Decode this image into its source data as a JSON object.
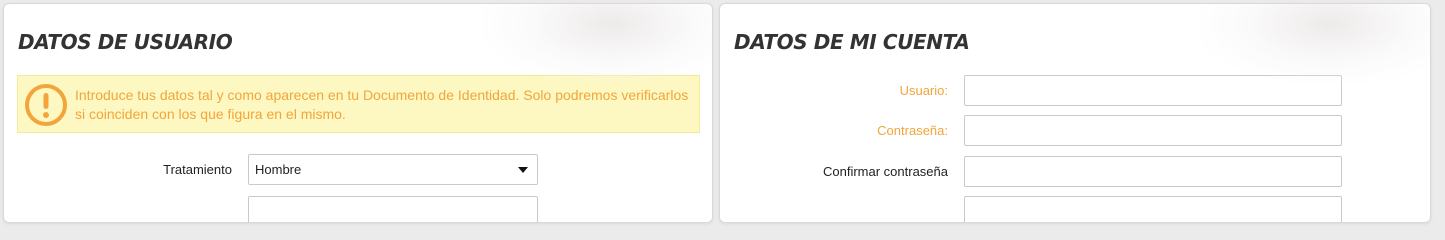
{
  "colors": {
    "accent": "#f2a53b",
    "alert_bg": "#fdf8c2",
    "title": "#333333"
  },
  "user_panel": {
    "title": "DATOS DE USUARIO",
    "alert": {
      "icon": "exclamation-circle-icon",
      "text": "Introduce tus datos tal y como aparecen en tu Documento de Identidad. Solo podremos verificarlos si coinciden con los que figura en el mismo."
    },
    "treatment": {
      "label": "Tratamiento",
      "value": "Hombre"
    }
  },
  "account_panel": {
    "title": "DATOS DE MI CUENTA",
    "username": {
      "label": "Usuario:",
      "value": ""
    },
    "password": {
      "label": "Contraseña:",
      "value": ""
    },
    "confirm_password": {
      "label": "Confirmar contraseña",
      "value": ""
    }
  }
}
